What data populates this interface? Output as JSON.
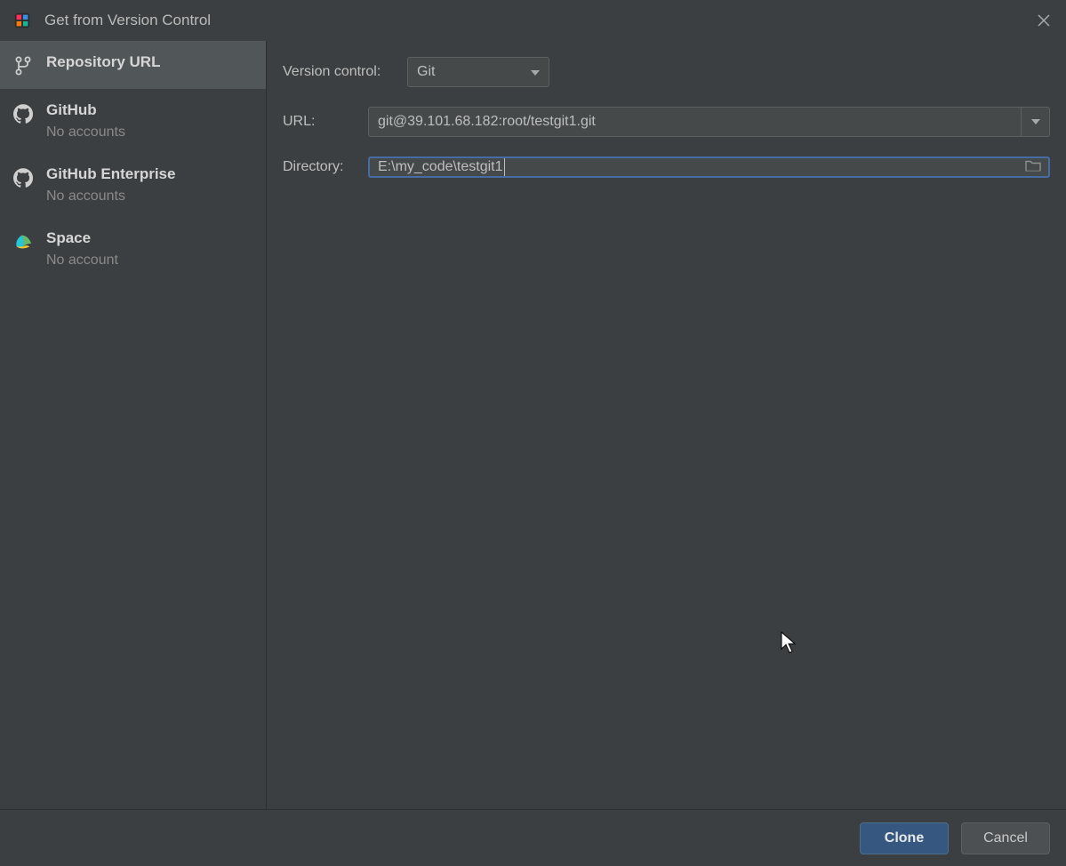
{
  "window": {
    "title": "Get from Version Control"
  },
  "sidebar": {
    "items": [
      {
        "title": "Repository URL",
        "sub": ""
      },
      {
        "title": "GitHub",
        "sub": "No accounts"
      },
      {
        "title": "GitHub Enterprise",
        "sub": "No accounts"
      },
      {
        "title": "Space",
        "sub": "No account"
      }
    ]
  },
  "form": {
    "vcs_label": "Version control:",
    "vcs_value": "Git",
    "url_label": "URL:",
    "url_value": "git@39.101.68.182:root/testgit1.git",
    "dir_label": "Directory:",
    "dir_value": "E:\\my_code\\testgit1"
  },
  "footer": {
    "clone": "Clone",
    "cancel": "Cancel"
  }
}
